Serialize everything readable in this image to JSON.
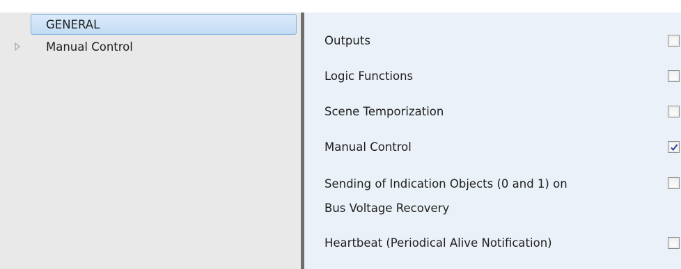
{
  "tree": {
    "items": [
      {
        "label": "GENERAL",
        "selected": true
      },
      {
        "label": "Manual Control",
        "selected": false,
        "expander": "triangle-right-icon"
      }
    ]
  },
  "params": {
    "rows": [
      {
        "label": "Outputs",
        "checked": false
      },
      {
        "label": "Logic Functions",
        "checked": false
      },
      {
        "label": "Scene Temporization",
        "checked": false
      },
      {
        "label": "Manual Control",
        "checked": true
      },
      {
        "label_line1": "Sending of Indication Objects (0 and 1) on",
        "label_line2": "Bus Voltage Recovery",
        "checked": false
      },
      {
        "label": "Heartbeat (Periodical Alive Notification)",
        "checked": false
      }
    ]
  },
  "colors": {
    "tree_bg": "#e9e9e9",
    "params_bg": "#ebf1f8",
    "selection": "#c2dcf4",
    "check_mark": "#2b3c9a"
  }
}
